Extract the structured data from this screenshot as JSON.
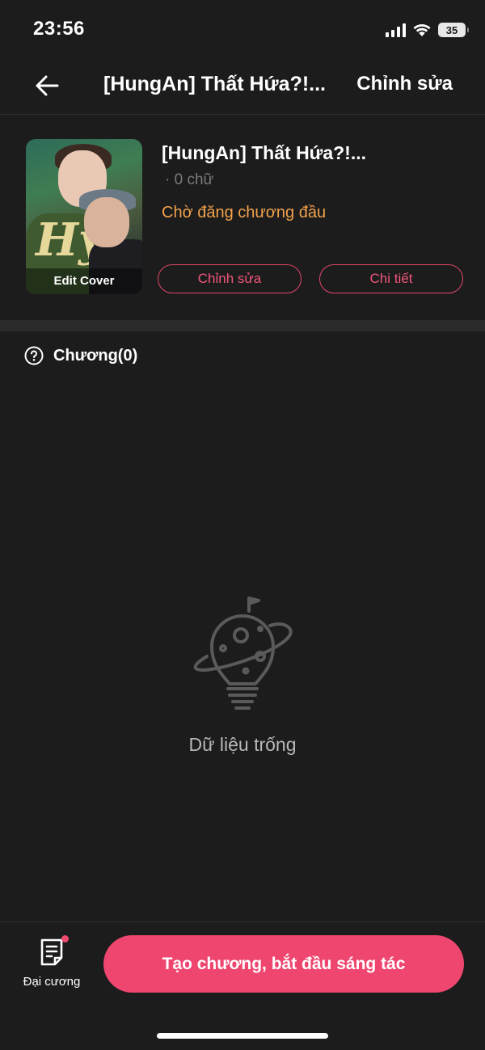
{
  "status_bar": {
    "time": "23:56",
    "battery": "35"
  },
  "nav": {
    "title": "[HungAn] Thất Hứa?!...",
    "edit_label": "Chỉnh sửa"
  },
  "book": {
    "cover_label": "Edit Cover",
    "title": "[HungAn] Thất Hứa?!...",
    "word_count": "· 0 chữ",
    "status": "Chờ đăng chương đầu",
    "edit_button": "Chỉnh sửa",
    "detail_button": "Chi tiết"
  },
  "chapters": {
    "label": "Chương(0)"
  },
  "empty_state": {
    "text": "Dữ liệu trống"
  },
  "bottom_bar": {
    "outline_label": "Đại cương",
    "create_button": "Tạo chương, bắt đầu sáng tác"
  },
  "colors": {
    "accent": "#ef4670",
    "status_orange": "#f1a24b",
    "background": "#1c1c1c"
  }
}
